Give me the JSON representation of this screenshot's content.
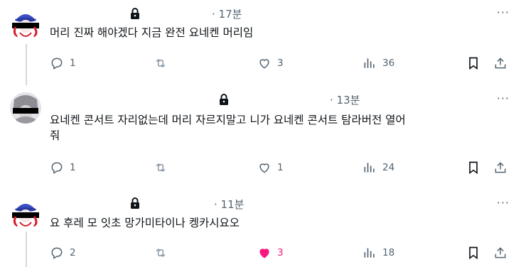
{
  "tweets": [
    {
      "time": "· 17분",
      "text": [
        "머리 진짜 해야겠다 지금 완전 요네켄 머리임"
      ],
      "replies": "1",
      "retweets": "",
      "likes": "3",
      "views": "36",
      "liked": false,
      "avatar": "anime-blue-hat"
    },
    {
      "time": "· 13분",
      "text": [
        "요네켄 콘서트 자리없는데 머리 자르지말고 니가 요네켄 콘서트 탐라버전 열어",
        "줘"
      ],
      "replies": "1",
      "retweets": "",
      "likes": "1",
      "views": "24",
      "liked": false,
      "avatar": "grey-character"
    },
    {
      "time": "· 11분",
      "text": [
        "요 후레 모 잇초 망가미타이나 켕카시요오"
      ],
      "replies": "2",
      "retweets": "",
      "likes": "3",
      "views": "18",
      "liked": true,
      "avatar": "anime-blue-hat"
    }
  ],
  "more_label": "···",
  "colors": {
    "muted": "#536471",
    "like": "#f91880",
    "thread": "#cfd9de",
    "text": "#0f1419"
  },
  "icons": [
    "reply-icon",
    "retweet-icon",
    "like-icon",
    "views-icon",
    "bookmark-icon",
    "share-icon",
    "lock-icon",
    "more-icon"
  ]
}
